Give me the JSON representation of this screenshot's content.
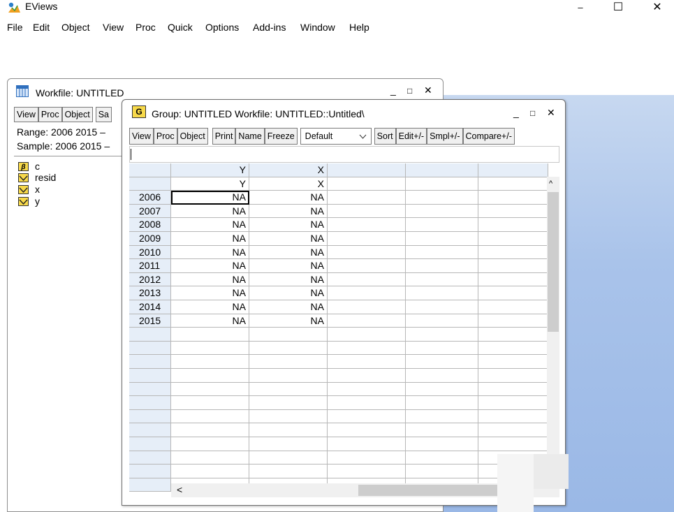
{
  "app": {
    "title": "EViews",
    "minimize": "–",
    "maximize": "☐",
    "close": "✕"
  },
  "menu": [
    "File",
    "Edit",
    "Object",
    "View",
    "Proc",
    "Quick",
    "Options",
    "Add-ins",
    "Window",
    "Help"
  ],
  "workfile": {
    "title": "Workfile: UNTITLED",
    "controls": {
      "min": "_",
      "max": "□",
      "close": "✕"
    },
    "toolbar": [
      "View",
      "Proc",
      "Object",
      "Sa"
    ],
    "range": "Range:  2006 2015   –",
    "sample": "Sample: 2006 2015   –",
    "objects": [
      {
        "name": "c",
        "icon": "coef-icon"
      },
      {
        "name": "resid",
        "icon": "series-icon"
      },
      {
        "name": "x",
        "icon": "series-icon"
      },
      {
        "name": "y",
        "icon": "series-icon"
      }
    ]
  },
  "group": {
    "icon_letter": "G",
    "title": "Group: UNTITLED   Workfile: UNTITLED::Untitled\\",
    "controls": {
      "min": "_",
      "max": "□",
      "close": "✕"
    },
    "toolbar_left": [
      "View",
      "Proc",
      "Object"
    ],
    "toolbar_mid": [
      "Print",
      "Name",
      "Freeze"
    ],
    "select_value": "Default",
    "toolbar_right": [
      "Sort",
      "Edit+/-",
      "Smpl+/-",
      "Compare+/-"
    ],
    "columns": [
      "Y",
      "X"
    ],
    "series_labels": [
      "Y",
      "X"
    ],
    "rows": [
      {
        "year": "2006",
        "y": "NA",
        "x": "NA"
      },
      {
        "year": "2007",
        "y": "NA",
        "x": "NA"
      },
      {
        "year": "2008",
        "y": "NA",
        "x": "NA"
      },
      {
        "year": "2009",
        "y": "NA",
        "x": "NA"
      },
      {
        "year": "2010",
        "y": "NA",
        "x": "NA"
      },
      {
        "year": "2011",
        "y": "NA",
        "x": "NA"
      },
      {
        "year": "2012",
        "y": "NA",
        "x": "NA"
      },
      {
        "year": "2013",
        "y": "NA",
        "x": "NA"
      },
      {
        "year": "2014",
        "y": "NA",
        "x": "NA"
      },
      {
        "year": "2015",
        "y": "NA",
        "x": "NA"
      }
    ],
    "empty_rows": 12,
    "scroll_up": "^",
    "scroll_left": "<"
  }
}
